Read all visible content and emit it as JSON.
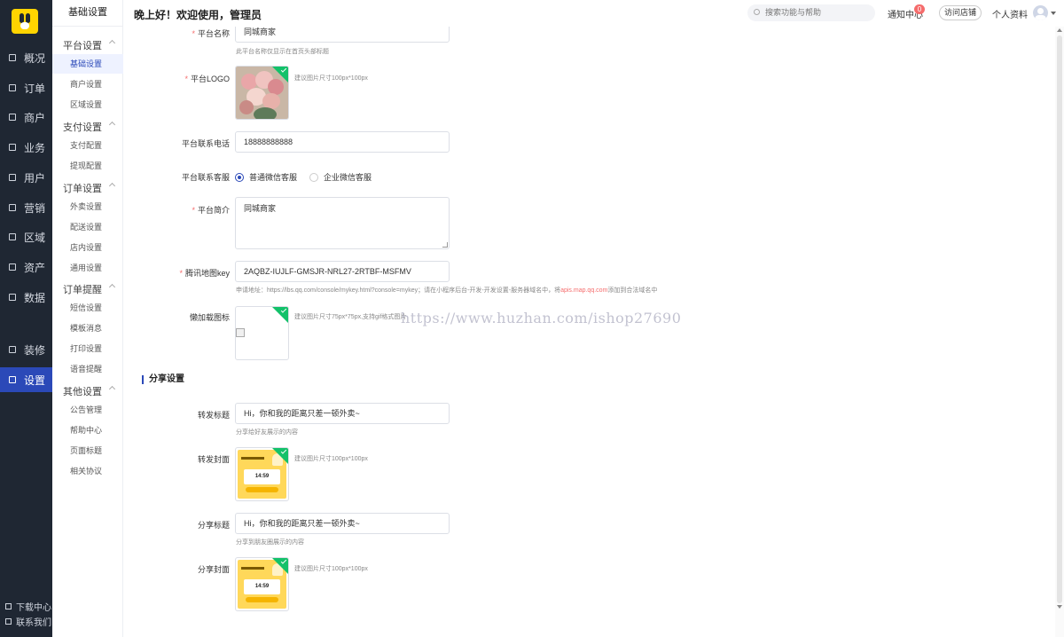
{
  "sidebar": {
    "items": [
      {
        "label": "概况",
        "icon": "dashboard-icon"
      },
      {
        "label": "订单",
        "icon": "order-icon"
      },
      {
        "label": "商户",
        "icon": "merchant-icon"
      },
      {
        "label": "业务",
        "icon": "business-icon"
      },
      {
        "label": "用户",
        "icon": "user-icon"
      },
      {
        "label": "营销",
        "icon": "marketing-icon"
      },
      {
        "label": "区域",
        "icon": "region-icon"
      },
      {
        "label": "资产",
        "icon": "assets-icon"
      },
      {
        "label": "数据",
        "icon": "data-icon"
      },
      {
        "label": "装修",
        "icon": "decorate-icon"
      },
      {
        "label": "设置",
        "icon": "settings-icon"
      }
    ],
    "download": "下载中心",
    "contact": "联系我们"
  },
  "subnav": {
    "title": "基础设置",
    "groups": [
      {
        "label": "平台设置",
        "items": [
          "基础设置",
          "商户设置",
          "区域设置"
        ]
      },
      {
        "label": "支付设置",
        "items": [
          "支付配置",
          "提现配置"
        ]
      },
      {
        "label": "订单设置",
        "items": [
          "外卖设置",
          "配送设置",
          "店内设置",
          "通用设置"
        ]
      },
      {
        "label": "订单提醒",
        "items": [
          "短信设置",
          "模板消息",
          "打印设置",
          "语音提醒"
        ]
      },
      {
        "label": "其他设置",
        "items": [
          "公告管理",
          "帮助中心",
          "页面标题",
          "相关协议"
        ]
      }
    ]
  },
  "header": {
    "greeting": "晚上好！欢迎使用，管理员",
    "search_placeholder": "搜索功能与帮助",
    "notify": "通知中心",
    "notify_count": "0",
    "visit_store": "访问店铺",
    "profile": "个人资料"
  },
  "form": {
    "platform_name_label": "平台名称",
    "platform_name": "同城商家",
    "platform_name_hint": "此平台名称仅显示在首页头部标题",
    "logo_label": "平台LOGO",
    "logo_hint": "建议图片尺寸100px*100px",
    "phone_label": "平台联系电话",
    "phone": "18888888888",
    "service_label": "平台联系客服",
    "service_opt1": "普通微信客服",
    "service_opt2": "企业微信客服",
    "intro_label": "平台简介",
    "intro": "同城商家",
    "mapkey_label": "腾讯地图key",
    "mapkey": "2AQBZ-IUJLF-GMSJR-NRL27-2RTBF-MSFMV",
    "mapkey_hint_a": "申请地址：https://lbs.qq.com/console/mykey.html?console=mykey；请在小程序后台-开发-开发设置-服务器域名中，将",
    "mapkey_hint_domain": "apis.map.qq.com",
    "mapkey_hint_b": "添加到合法域名中",
    "lazy_label": "懒加载图标",
    "lazy_hint": "建议图片尺寸75px*75px,支持gif格式图片",
    "share_section": "分享设置",
    "fwd_title_label": "转发标题",
    "fwd_title": "Hi，你和我的距离只差一顿外卖~",
    "fwd_title_hint": "分享给好友展示的内容",
    "fwd_cover_label": "转发封面",
    "fwd_cover_hint": "建议图片尺寸100px*100px",
    "share_title_label": "分享标题",
    "share_title": "Hi，你和我的距离只差一顿外卖~",
    "share_title_hint": "分享到朋友圈展示的内容",
    "share_cover_label": "分享封面",
    "share_cover_hint": "建议图片尺寸100px*100px",
    "cover_time": "14:59"
  },
  "watermark": "https://www.huzhan.com/ishop27690",
  "colors": {
    "sidebar_bg": "#1f2733",
    "accent": "#2b49b8",
    "required": "#f56c6c",
    "check_corner": "#13c16a",
    "cover_bg": "#ffd85a"
  }
}
